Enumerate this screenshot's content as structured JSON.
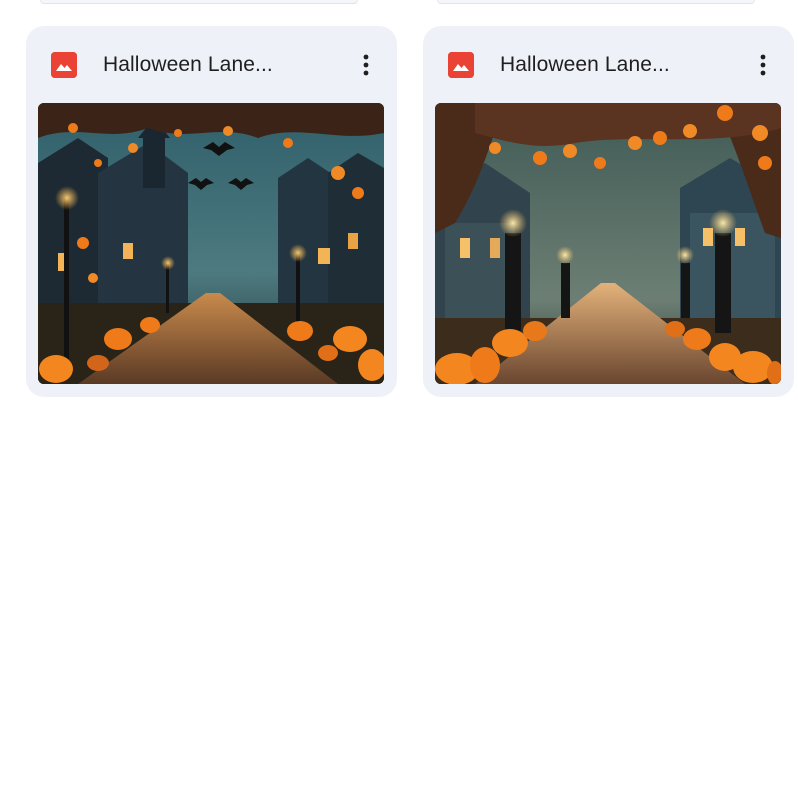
{
  "cards": [
    {
      "name": "Halloween Lane...",
      "file_type_icon": "image-file-icon",
      "menu_icon": "more-vert-icon",
      "thumbnail": "halloween-lane-image-1"
    },
    {
      "name": "Halloween Lane...",
      "file_type_icon": "image-file-icon",
      "menu_icon": "more-vert-icon",
      "thumbnail": "halloween-lane-image-2"
    }
  ],
  "colors": {
    "card_background": "#eef1f7",
    "image_icon_red": "#ea4335",
    "title_text": "#1f1f1f",
    "page_background": "#ffffff"
  }
}
